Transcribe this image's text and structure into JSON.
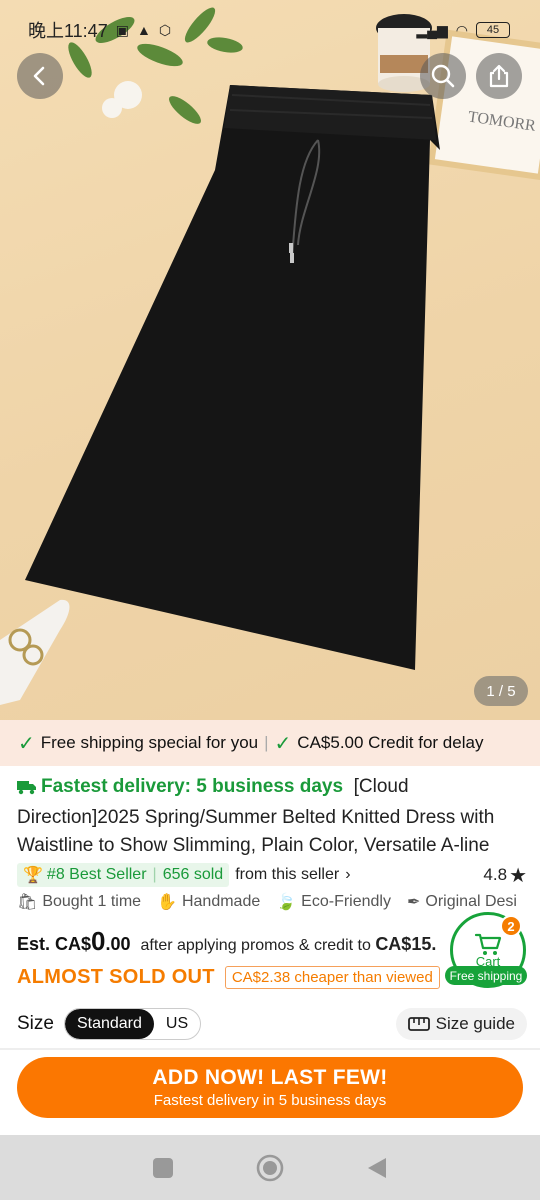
{
  "status_bar": {
    "time": "晚上11:47",
    "battery": "45"
  },
  "gallery": {
    "counter": "1 / 5",
    "decor_text": "TOMORR"
  },
  "promo_bar": {
    "item1": "Free shipping special for you",
    "item2": "CA$5.00 Credit for delay"
  },
  "product": {
    "delivery": "Fastest delivery: 5 business days",
    "title": "[Cloud Direction]2025 Spring/Summer Belted Knitted Dress with Waistline to Show Slimming, Plain Color, Versatile A-line",
    "best_seller": "#8 Best Seller",
    "sold": "656 sold",
    "from_seller": "from this seller",
    "rating": "4.8",
    "features": [
      "Bought 1 time",
      "Handmade",
      "Eco-Friendly",
      "Original Desi"
    ],
    "est_prefix": "Est. CA$",
    "est_big": "0",
    "est_cents": ".00",
    "after_promo": "after applying promos & credit to ",
    "after_price": "CA$15.",
    "almost_sold": "ALMOST SOLD OUT",
    "cheaper": "CA$2.38 cheaper than viewed"
  },
  "cart": {
    "label": "Cart",
    "count": "2",
    "free_shipping": "Free shipping"
  },
  "size": {
    "label": "Size",
    "options": [
      "Standard",
      "US"
    ],
    "selected": "Standard",
    "guide": "Size guide"
  },
  "cta": {
    "main": "ADD NOW! LAST FEW!",
    "sub": "Fastest delivery in 5 business days"
  },
  "colors": {
    "accent_orange": "#fb7701",
    "accent_green": "#1a9a3a"
  }
}
